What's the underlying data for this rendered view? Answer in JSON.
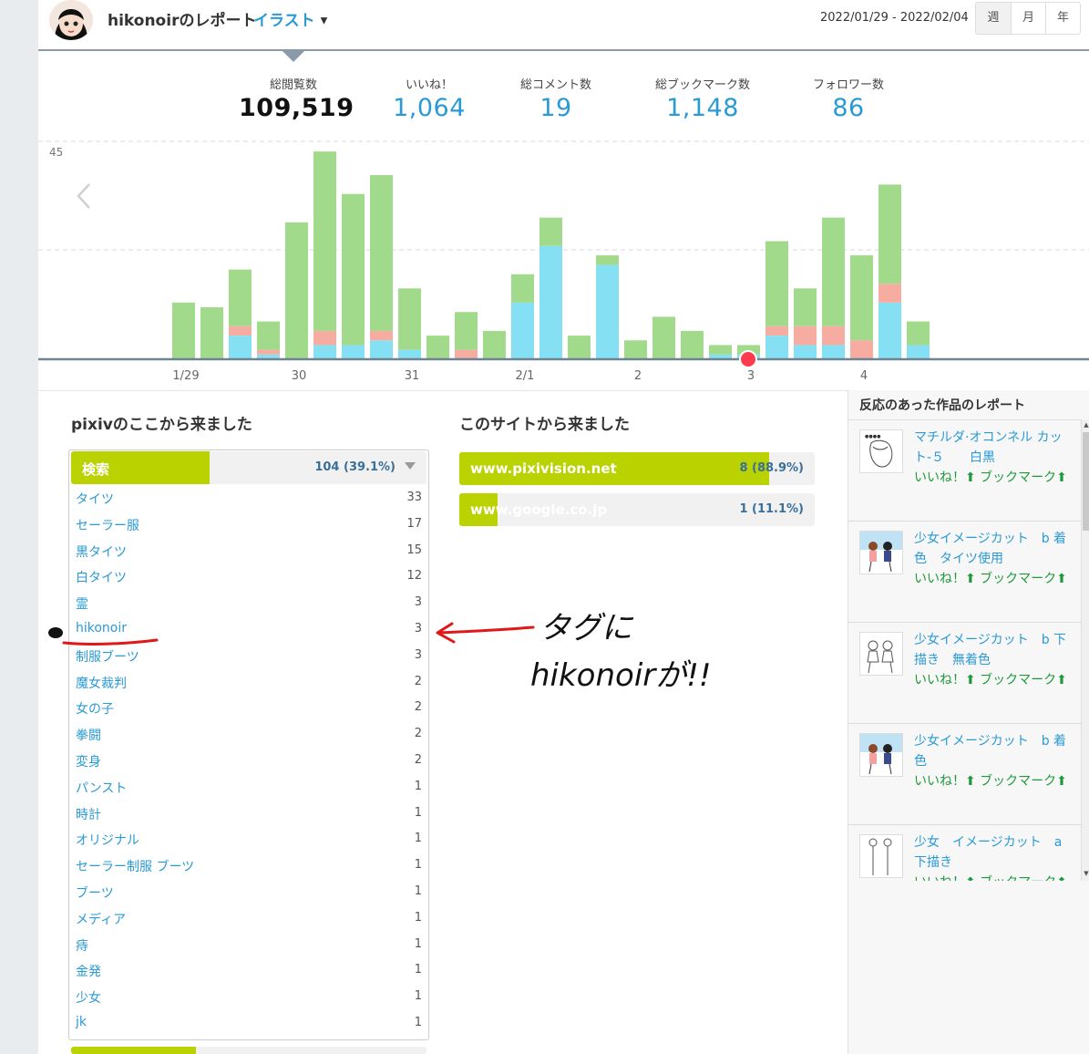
{
  "header": {
    "report_title": "hikonoirのレポート",
    "type_select": "イラスト",
    "date_range": "2022/01/29 - 2022/02/04",
    "periods": [
      "週",
      "月",
      "年"
    ]
  },
  "stats": [
    {
      "label": "総閲覧数",
      "value": "109,519"
    },
    {
      "label": "いいね！",
      "value": "1,064"
    },
    {
      "label": "総コメント数",
      "value": "19"
    },
    {
      "label": "総ブックマーク数",
      "value": "1,148"
    },
    {
      "label": "フォロワー数",
      "value": "86"
    }
  ],
  "colors": {
    "green": "#a1da8a",
    "pink": "#f7aca2",
    "blue": "#86e0f3",
    "accent": "#b9d200",
    "link": "#2a9ad5"
  },
  "chart_data": {
    "type": "bar",
    "stacked": true,
    "y_tick_label": "45",
    "ylim": [
      0,
      45
    ],
    "x_tick_labels": [
      "1/29",
      "30",
      "31",
      "2/1",
      "2",
      "3",
      "4"
    ],
    "series": [
      {
        "values": [
          0,
          0,
          5,
          1,
          0,
          3,
          3,
          4,
          2,
          0,
          0,
          0,
          12,
          24,
          0,
          20,
          0,
          0,
          0,
          1,
          1,
          5,
          3,
          3,
          0,
          12,
          3
        ]
      },
      {
        "values": [
          0,
          0,
          2,
          1,
          0,
          3,
          0,
          2,
          0,
          0,
          2,
          0,
          0,
          0,
          0,
          0,
          0,
          0,
          0,
          0,
          0,
          2,
          4,
          4,
          4,
          4,
          0
        ]
      },
      {
        "values": [
          12,
          11,
          12,
          6,
          29,
          38,
          32,
          33,
          13,
          5,
          8,
          6,
          6,
          6,
          5,
          2,
          4,
          9,
          6,
          2,
          2,
          18,
          8,
          23,
          18,
          21,
          5
        ]
      }
    ]
  },
  "referrers": {
    "pixiv_title": "pixivのここから来ました",
    "search": {
      "name": "検索",
      "value": "104 (39.1%)",
      "percent": 39.1
    },
    "tags": [
      {
        "name": "タイツ",
        "count": "33"
      },
      {
        "name": "セーラー服",
        "count": "17"
      },
      {
        "name": "黒タイツ",
        "count": "15"
      },
      {
        "name": "白タイツ",
        "count": "12"
      },
      {
        "name": "霊",
        "count": "3"
      },
      {
        "name": "hikonoir",
        "count": "3"
      },
      {
        "name": "制服ブーツ",
        "count": "3"
      },
      {
        "name": "魔女裁判",
        "count": "2"
      },
      {
        "name": "女の子",
        "count": "2"
      },
      {
        "name": "拳闘",
        "count": "2"
      },
      {
        "name": "変身",
        "count": "2"
      },
      {
        "name": "パンスト",
        "count": "1"
      },
      {
        "name": "時計",
        "count": "1"
      },
      {
        "name": "オリジナル",
        "count": "1"
      },
      {
        "name": "セーラー制服 ブーツ",
        "count": "1"
      },
      {
        "name": "ブーツ",
        "count": "1"
      },
      {
        "name": "メディア",
        "count": "1"
      },
      {
        "name": "痔",
        "count": "1"
      },
      {
        "name": "金発",
        "count": "1"
      },
      {
        "name": "少女",
        "count": "1"
      },
      {
        "name": "jk",
        "count": "1"
      }
    ],
    "site_title": "このサイトから来ました",
    "sites": [
      {
        "name": "www.pixivision.net",
        "value": "8 (88.9%)",
        "percent": 88.9
      },
      {
        "name": "www.google.co.jp",
        "value": "1 (11.1%)",
        "percent": 11.1
      }
    ]
  },
  "works_panel": {
    "title": "反応のあった作品のレポート",
    "works": [
      {
        "title": "マチルダ·オコンネル カット-５　　白黒",
        "reactions": "いいね！⬆ ブックマーク⬆"
      },
      {
        "title": "少女イメージカット　b 着色　タイツ使用",
        "reactions": "いいね！⬆ ブックマーク⬆"
      },
      {
        "title": "少女イメージカット　b 下描き　無着色",
        "reactions": "いいね！⬆ ブックマーク⬆"
      },
      {
        "title": "少女イメージカット　b 着色",
        "reactions": "いいね！⬆ ブックマーク⬆"
      },
      {
        "title": "少女　イメージカット　a 下描き",
        "reactions": "いいね！⬆ ブックマーク⬆"
      }
    ]
  },
  "annotation": {
    "line1": "タグに",
    "line2": "hikonoirが!!"
  }
}
